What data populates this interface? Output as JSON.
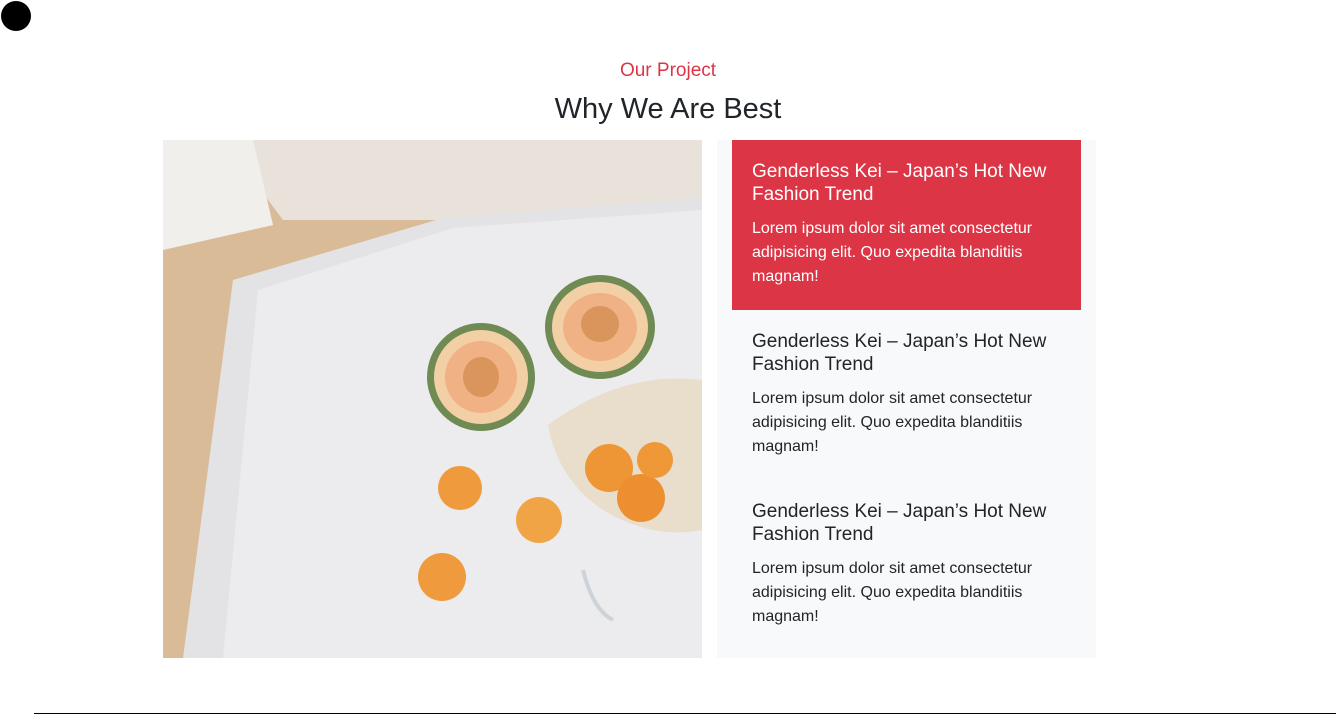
{
  "header": {
    "eyebrow": "Our Project",
    "title": "Why We Are Best"
  },
  "photo": {
    "alt": "Melon halves and apricots on a white table"
  },
  "features": [
    {
      "title": "Genderless Kei – Japan’s Hot New Fashion Trend",
      "text": "Lorem ipsum dolor sit amet consectetur adipisicing elit. Quo expedita blanditiis magnam!",
      "active": true
    },
    {
      "title": "Genderless Kei – Japan’s Hot New Fashion Trend",
      "text": "Lorem ipsum dolor sit amet consectetur adipisicing elit. Quo expedita blanditiis magnam!",
      "active": false
    },
    {
      "title": "Genderless Kei – Japan’s Hot New Fashion Trend",
      "text": "Lorem ipsum dolor sit amet consectetur adipisicing elit. Quo expedita blanditiis magnam!",
      "active": false
    }
  ],
  "colors": {
    "accent": "#dc3545",
    "panel_bg": "#f8f9fa",
    "text": "#212529"
  }
}
